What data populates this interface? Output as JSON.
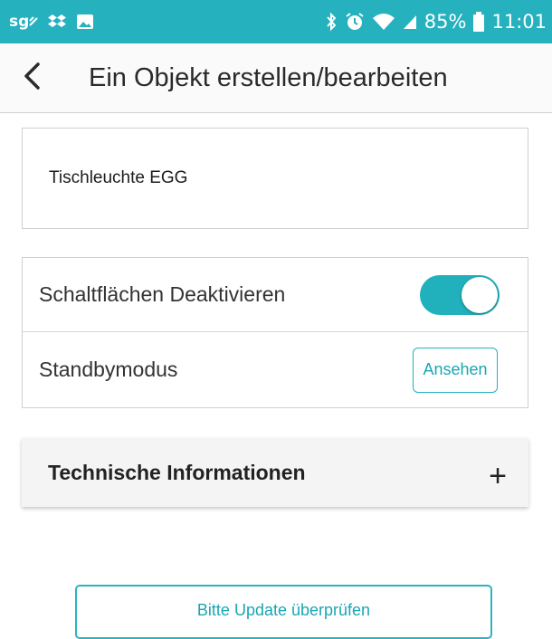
{
  "status_bar": {
    "left_text": "sg",
    "battery_percent": "85%",
    "time": "11:01",
    "icons": [
      "sg-signal-icon",
      "dropbox-icon",
      "image-icon",
      "bluetooth-icon",
      "alarm-icon",
      "wifi-icon",
      "cell-signal-icon",
      "battery-icon"
    ]
  },
  "app_bar": {
    "title": "Ein Objekt erstellen/bearbeiten",
    "back_icon": "chevron-left-icon"
  },
  "object": {
    "name": "Tischleuchte EGG"
  },
  "settings": {
    "disable_buttons_label": "Schaltflächen Deaktivieren",
    "disable_buttons_on": true,
    "standby_label": "Standbymodus",
    "standby_button": "Ansehen"
  },
  "tech_info": {
    "title": "Technische Informationen",
    "expand_symbol": "+"
  },
  "update": {
    "label": "Bitte Update überprüfen"
  },
  "colors": {
    "accent": "#26b1be",
    "toggle_on": "#21b1bd"
  }
}
